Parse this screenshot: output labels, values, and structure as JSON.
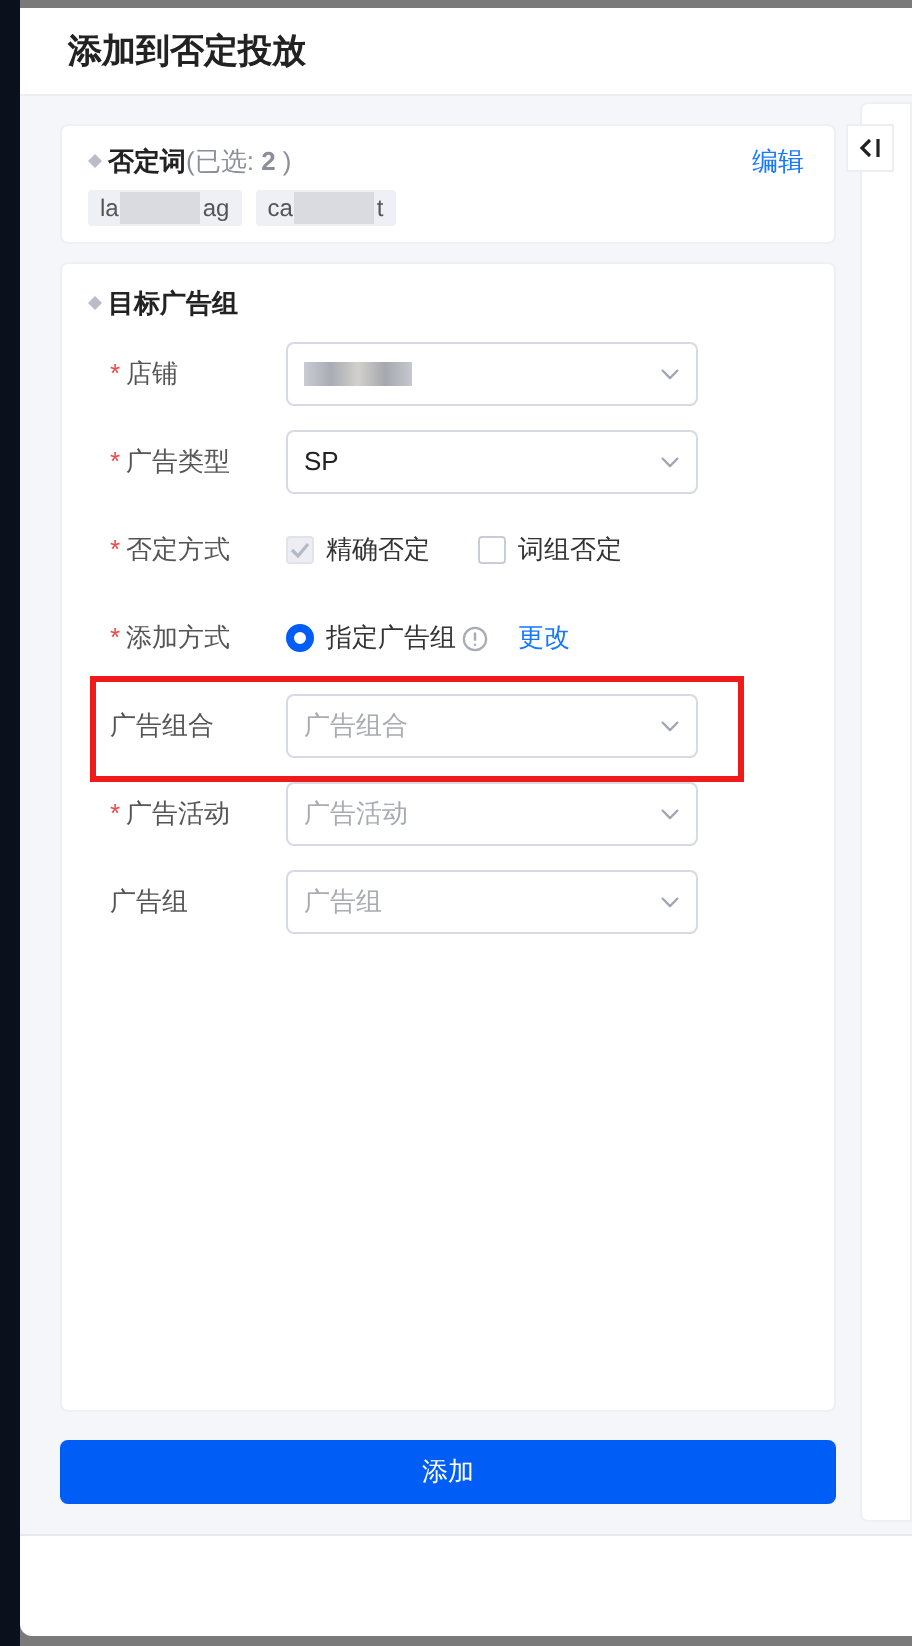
{
  "title": "添加到否定投放",
  "keywords": {
    "label": "否定词",
    "count": "(已选: **2** )",
    "edit": "编辑",
    "tags": [
      {
        "start": "la",
        "end": "ag"
      },
      {
        "start": "ca",
        "end": "t"
      }
    ]
  },
  "target": {
    "heading": "目标广告组",
    "fields": [
      {
        "kind": "select",
        "required_mark": "*",
        "label": "店铺",
        "redacted": true
      },
      {
        "kind": "select",
        "required_mark": "*",
        "label": "广告类型",
        "value": "SP"
      },
      {
        "kind": "checkboxes",
        "required_mark": "*",
        "label": "否定方式",
        "options": [
          {
            "label": "精确否定",
            "checked": true,
            "disabled": true
          },
          {
            "label": "词组否定",
            "checked": false,
            "disabled": false
          }
        ]
      },
      {
        "kind": "radio",
        "required_mark": "*",
        "label": "添加方式",
        "option": {
          "label": "指定广告组",
          "selected": true
        },
        "link": "更改"
      },
      {
        "kind": "select",
        "label": "广告组合",
        "placeholder": "广告组合",
        "highlighted": true
      },
      {
        "kind": "select",
        "required_mark": "*",
        "label": "广告活动",
        "placeholder": "广告活动"
      },
      {
        "kind": "select",
        "label": "广告组",
        "placeholder": "广告组"
      }
    ]
  },
  "submit": "添加"
}
